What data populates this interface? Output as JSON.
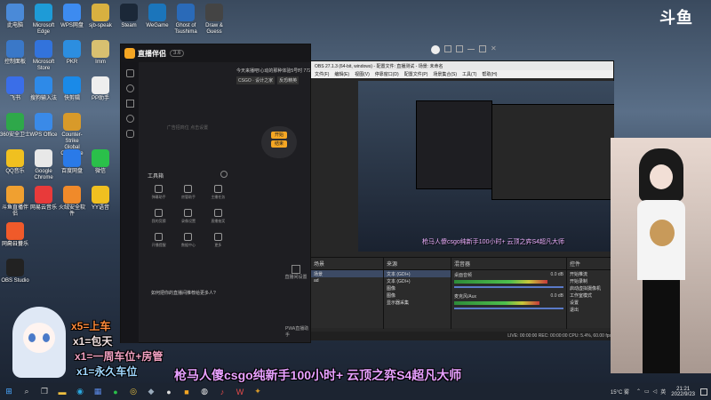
{
  "desktop_icons": [
    {
      "label": "此电脑",
      "color": "#4a8ad8"
    },
    {
      "label": "Microsoft Edge",
      "color": "#1e9bd7"
    },
    {
      "label": "WPS网盘",
      "color": "#3d8bf0"
    },
    {
      "label": "sjb-speak",
      "color": "#d8b040"
    },
    {
      "label": "Steam",
      "color": "#1b2838"
    },
    {
      "label": "WeGame",
      "color": "#1b75bb"
    },
    {
      "label": "Ghost of Tsushima",
      "color": "#2a6ab8"
    },
    {
      "label": "Draw & Guess",
      "color": "#444"
    },
    {
      "label": "控制面板",
      "color": "#3a78c8"
    },
    {
      "label": "Microsoft Store",
      "color": "#3273dc"
    },
    {
      "label": "PKR",
      "color": "#2c8ee0"
    },
    {
      "label": "Imm",
      "color": "#d8c070"
    },
    {
      "label": "飞书",
      "color": "#3a6ee8"
    },
    {
      "label": "搜狗输入法",
      "color": "#2e8ae8"
    },
    {
      "label": "快剪辑",
      "color": "#1a8ae8"
    },
    {
      "label": "PP助手",
      "color": "#eeeeee"
    },
    {
      "label": "360安全卫士",
      "color": "#2ea84a"
    },
    {
      "label": "WPS Office",
      "color": "#3a8ae8"
    },
    {
      "label": "网易云音乐",
      "color": "#e84a4a"
    },
    {
      "label": "Counter-Strike Global Offensive",
      "color": "#d89a2a"
    },
    {
      "label": "QQ音乐",
      "color": "#f0c020"
    },
    {
      "label": "Google Chrome",
      "color": "#e8e8e8"
    },
    {
      "label": "百度网盘",
      "color": "#2a7ae8"
    },
    {
      "label": "微信",
      "color": "#2ac04a"
    },
    {
      "label": "网易云音乐",
      "color": "#e83a3a"
    },
    {
      "label": "斗鱼直播伴侣",
      "color": "#f0a030"
    },
    {
      "label": "火绒安全软件",
      "color": "#f08a2a"
    },
    {
      "label": "YY语音",
      "color": "#f0c020"
    },
    {
      "label": "向日葵",
      "color": "#f05a2a"
    },
    {
      "label": "OBS Studio",
      "color": "#222"
    }
  ],
  "douyu_logo": "斗鱼",
  "companion_window": {
    "title": "直播伴侣",
    "version": "3.6",
    "notice": "今天来播吧!心动的那种体验5号时 772",
    "game_tag": "CSGO · 设计之家",
    "game_tag2": "反恐精英",
    "placeholder": "广告招商位 点击设置",
    "start_button": "开始",
    "stop_button": "结束",
    "toolbox_title": "工具箱",
    "tools": [
      "弹幕助手",
      "房管助手",
      "主播任务",
      "我的竞猜",
      "录像设置",
      "直播抽奖",
      "开播提醒",
      "数据中心",
      "更多"
    ],
    "help_text": "如何把你的直播间推荐给更多人?",
    "side_label": "直播间设置",
    "bottom_label": "PWA直播助手"
  },
  "obs_window": {
    "title": "OBS 27.1.3 (64-bit, windows) - 配置文件: 直播测试 - 场景: 未命名",
    "menu": [
      "文件(F)",
      "编辑(E)",
      "视图(V)",
      "停靠窗口(D)",
      "配置文件(P)",
      "场景集合(S)",
      "工具(T)",
      "帮助(H)"
    ],
    "scenes_title": "场景",
    "scenes": [
      "场景",
      "ad"
    ],
    "sources_title": "来源",
    "sources": [
      "文本 (GDI+)",
      "文本 (GDI+)",
      "图像",
      "图像",
      "显示器采集"
    ],
    "mixer_title": "混音器",
    "mixer_items": [
      {
        "name": "桌面音频",
        "db": "0.0 dB",
        "level": 0.85
      },
      {
        "name": "麦克风/Aux",
        "db": "0.0 dB",
        "level": 0.78
      }
    ],
    "controls_title": "控件",
    "controls": [
      "开始推流",
      "开始录制",
      "启动虚拟摄像机",
      "工作室模式",
      "设置",
      "退出"
    ],
    "status": "LIVE: 00:00:00   REC: 00:00:00   CPU: 5.4%, 60.00 fps"
  },
  "nested_overlay_text": "枪马人傻csgo纯新手100小时+ 云顶之弈S4超凡大师",
  "gift_lines": [
    {
      "text": "x5=上车",
      "color": "#ff8a3a"
    },
    {
      "text": "x1=包天",
      "color": "#f0e0e0"
    },
    {
      "text": "x1=一周车位+房管",
      "color": "#f0a0c0"
    },
    {
      "text": "x1=永久车位",
      "color": "#a0d8ff"
    }
  ],
  "stream_title": "枪马人傻csgo纯新手100小时+ 云顶之弈S4超凡大师",
  "tray": {
    "temperature": "15°C 雾",
    "time": "21:21",
    "date": "2022/9/23",
    "ime": "英"
  },
  "colors": {
    "obs_bg": "#272727",
    "companion_bg": "#1e1e22",
    "accent_orange": "#f5a623",
    "title_purple": "#e8a0ff"
  }
}
